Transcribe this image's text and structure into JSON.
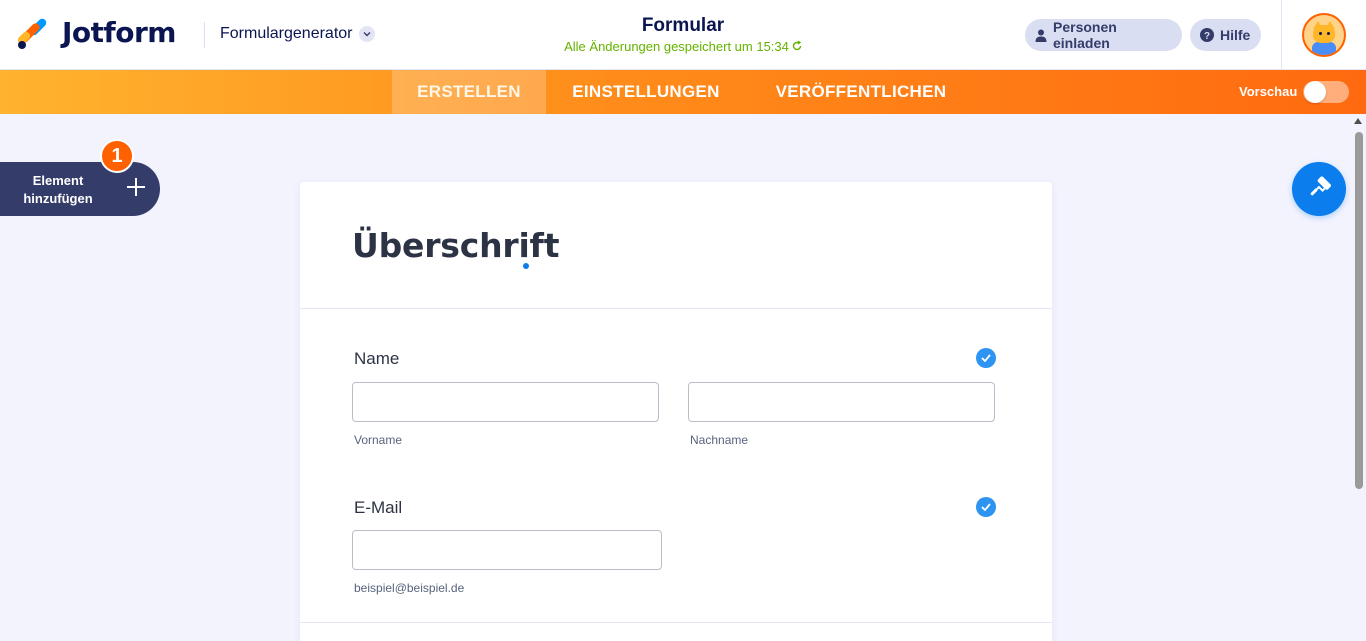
{
  "header": {
    "logo_text": "Jotform",
    "builder_menu": "Formulargenerator",
    "form_title": "Formular",
    "save_status": "Alle Änderungen gespeichert um 15:34",
    "invite_label": "Personen einladen",
    "help_label": "Hilfe",
    "avatar_icon": "cat-avatar-icon"
  },
  "nav": {
    "tabs": [
      "ERSTELLEN",
      "EINSTELLUNGEN",
      "VERÖFFENTLICHEN"
    ],
    "active_tab": "ERSTELLEN",
    "preview_label": "Vorschau",
    "preview_on": false
  },
  "sidebar": {
    "add_element_label": "Element hinzufügen",
    "badge_count": "1"
  },
  "form": {
    "heading": "Überschrift",
    "fields": [
      {
        "label": "Name",
        "sublabels": [
          "Vorname",
          "Nachname"
        ],
        "values": [
          "",
          ""
        ]
      },
      {
        "label": "E-Mail",
        "sublabels": [
          "beispiel@beispiel.de"
        ],
        "values": [
          ""
        ]
      }
    ]
  },
  "colors": {
    "brand_orange": "#ff6100",
    "brand_navy": "#0a1551",
    "accent_blue": "#0b7dec",
    "save_green": "#64b200",
    "nav_gradient_start": "#ffb32f",
    "nav_gradient_end": "#ff6a10"
  }
}
